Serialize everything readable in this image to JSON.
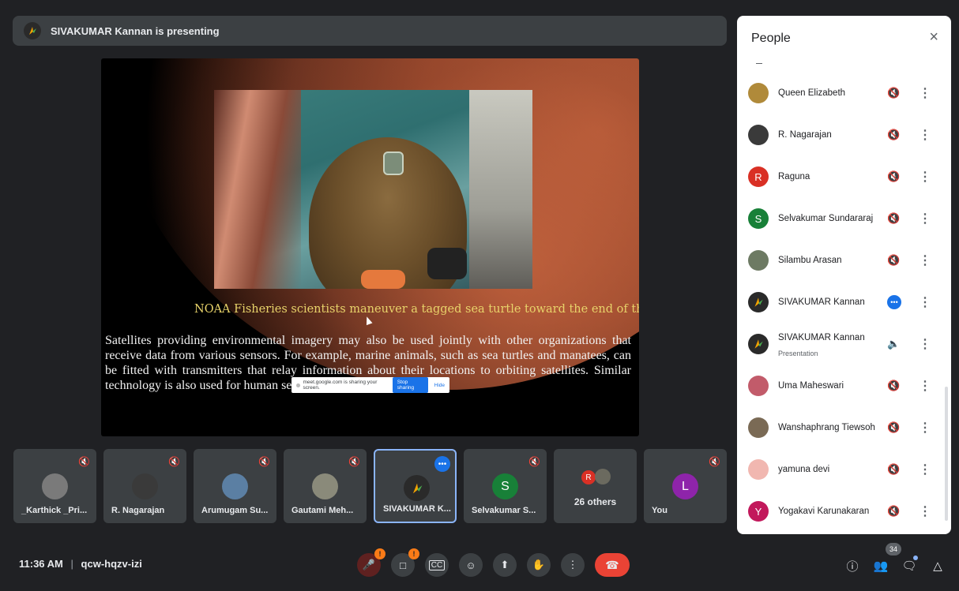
{
  "presenter_bar": {
    "title": "SIVAKUMAR Kannan is presenting"
  },
  "slide": {
    "caption": "NOAA Fisheries scientists maneuver a tagged sea turtle toward the end of the boat ramp.",
    "body": "Satellites providing environmental imagery may also be used jointly with other organizations that receive data from various sensors. For example, marine animals, such as sea turtles and manatees, can be fitted with transmitters that relay information about their locations to orbiting satellites. Similar technology is also used for human search and rescue."
  },
  "share_notice": {
    "text": "meet.google.com is sharing your screen.",
    "stop_label": "Stop sharing",
    "hide_label": "Hide"
  },
  "tiles": [
    {
      "name": "_Karthick _Pri...",
      "avatar_color": "#7a7a7a",
      "initial": "",
      "muted": true
    },
    {
      "name": "R. Nagarajan",
      "avatar_color": "#3a3a3a",
      "initial": "",
      "muted": true
    },
    {
      "name": "Arumugam Su...",
      "avatar_color": "#5b7fa3",
      "initial": "",
      "muted": true
    },
    {
      "name": "Gautami Meh...",
      "avatar_color": "#8a8a7a",
      "initial": "",
      "muted": true
    },
    {
      "name": "SIVAKUMAR K...",
      "avatar_color": "#2a2a2a",
      "initial": "",
      "muted": false
    },
    {
      "name": "Selvakumar S...",
      "avatar_color": "#188038",
      "initial": "S",
      "muted": true
    },
    {
      "name": "26 others",
      "avatar_color": "",
      "initial": "R",
      "muted": false
    },
    {
      "name": "You",
      "avatar_color": "#8e24aa",
      "initial": "L",
      "muted": true
    }
  ],
  "meeting": {
    "time": "11:36 AM",
    "code": "qcw-hqzv-izi",
    "separator": "|"
  },
  "controls": {
    "mic_icon": "mic-off-icon",
    "camera_icon": "camera-off-icon",
    "captions_icon": "captions-icon",
    "emoji_icon": "emoji-icon",
    "present_icon": "present-icon",
    "hand_icon": "raise-hand-icon",
    "more_icon": "more-vert-icon",
    "end_icon": "end-call-icon"
  },
  "right_controls": {
    "people_count": "34"
  },
  "people_panel": {
    "title": "People",
    "close_glyph": "×",
    "people": [
      {
        "name": "Queen Elizabeth",
        "sub": "",
        "initial": "",
        "color": "#b08a3a",
        "status": "muted"
      },
      {
        "name": "R. Nagarajan",
        "sub": "",
        "initial": "",
        "color": "#3a3a3a",
        "status": "muted"
      },
      {
        "name": "Raguna",
        "sub": "",
        "initial": "R",
        "color": "#d93025",
        "status": "muted"
      },
      {
        "name": "Selvakumar Sundararaj",
        "sub": "",
        "initial": "S",
        "color": "#188038",
        "status": "muted"
      },
      {
        "name": "Silambu Arasan",
        "sub": "",
        "initial": "",
        "color": "#6d7a63",
        "status": "muted"
      },
      {
        "name": "SIVAKUMAR Kannan",
        "sub": "",
        "initial": "",
        "color": "#2a2a2a",
        "status": "speaking"
      },
      {
        "name": "SIVAKUMAR Kannan",
        "sub": "Presentation",
        "initial": "",
        "color": "#2a2a2a",
        "status": "presenting"
      },
      {
        "name": "Uma Maheswari",
        "sub": "",
        "initial": "",
        "color": "#c25b6a",
        "status": "muted"
      },
      {
        "name": "Wanshaphrang Tiewsoh",
        "sub": "",
        "initial": "",
        "color": "#7a6a55",
        "status": "muted"
      },
      {
        "name": "yamuna devi",
        "sub": "",
        "initial": "",
        "color": "#f1b7b0",
        "status": "muted"
      },
      {
        "name": "Yogakavi Karunakaran",
        "sub": "",
        "initial": "Y",
        "color": "#c2185b",
        "status": "muted"
      }
    ]
  }
}
